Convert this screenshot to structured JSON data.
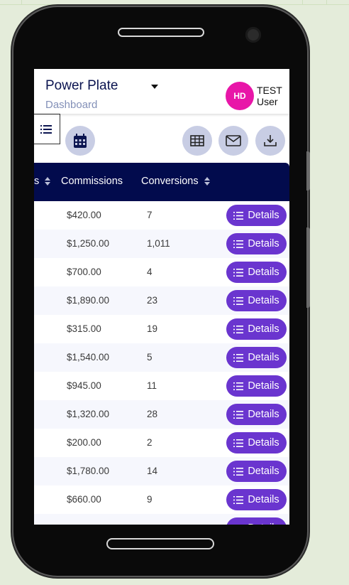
{
  "app": {
    "brand": "Power Plate",
    "breadcrumb": "Dashboard"
  },
  "user": {
    "initials": "HD",
    "name_line1": "TEST",
    "name_line2": "User"
  },
  "colors": {
    "header_bg": "#020b4d",
    "details_button": "#6a35cf",
    "avatar": "#e816a8",
    "icon_circle": "#c8cde4",
    "page_bg": "#e4ecda"
  },
  "toolbar": {
    "icons": [
      "list-icon",
      "calendar-icon",
      "table-icon",
      "mail-icon",
      "download-icon"
    ]
  },
  "table": {
    "columns": {
      "partial_col": "s",
      "commissions": "Commissions",
      "conversions": "Conversions"
    },
    "details_label": "Details",
    "rows": [
      {
        "commission": "$420.00",
        "conversions": "7"
      },
      {
        "commission": "$1,250.00",
        "conversions": "1,011"
      },
      {
        "commission": "$700.00",
        "conversions": "4"
      },
      {
        "commission": "$1,890.00",
        "conversions": "23"
      },
      {
        "commission": "$315.00",
        "conversions": "19"
      },
      {
        "commission": "$1,540.00",
        "conversions": "5"
      },
      {
        "commission": "$945.00",
        "conversions": "11"
      },
      {
        "commission": "$1,320.00",
        "conversions": "28"
      },
      {
        "commission": "$200.00",
        "conversions": "2"
      },
      {
        "commission": "$1,780.00",
        "conversions": "14"
      },
      {
        "commission": "$660.00",
        "conversions": "9"
      },
      {
        "commission": "",
        "conversions": ""
      }
    ]
  }
}
